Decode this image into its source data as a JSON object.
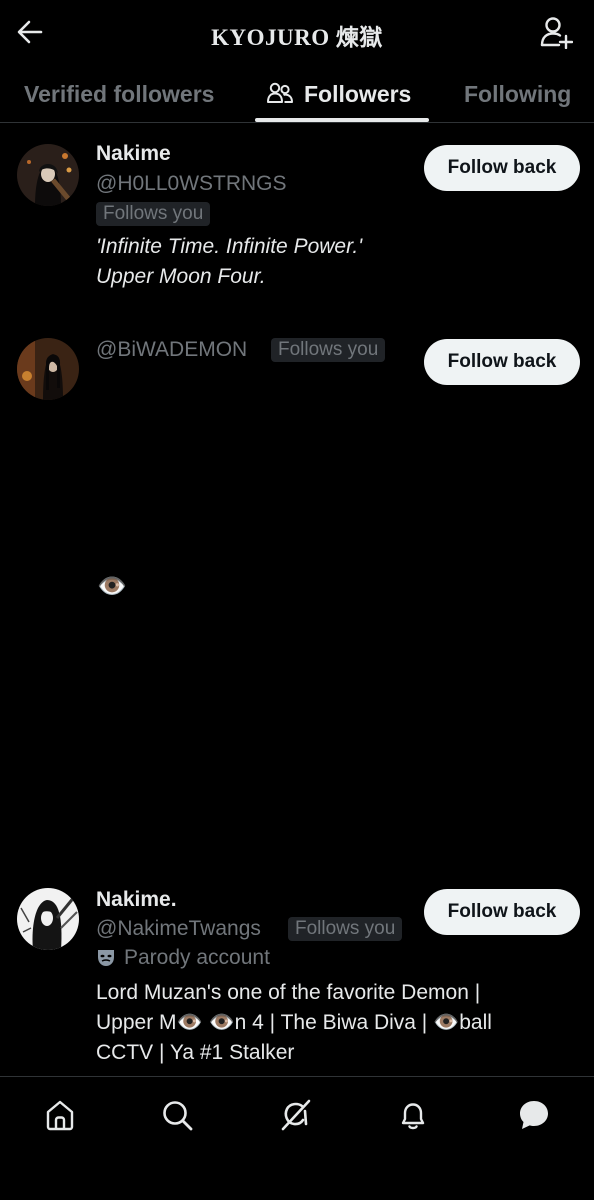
{
  "header": {
    "title": "KYOJURO 煉獄",
    "back_icon": "arrow-left-icon",
    "add_user_icon": "add-user-icon"
  },
  "tabs": [
    {
      "label": "Verified followers",
      "active": false
    },
    {
      "label": "Followers",
      "active": true,
      "icon": "people-icon"
    },
    {
      "label": "Following",
      "active": false
    }
  ],
  "followers": [
    {
      "name": "Nakime",
      "handle": "@H0LL0WSTRNGS",
      "follows_you": "Follows you",
      "button": "Follow back",
      "bio_line1": "'Infinite Time. Infinite Power.'",
      "bio_line2": "Upper Moon Four."
    },
    {
      "name": "",
      "handle": "@BiWADEMON",
      "follows_you": "Follows you",
      "button": "Follow back",
      "bio": "👁️"
    },
    {
      "name": "Nakime.",
      "handle": "@NakimeTwangs",
      "follows_you": "Follows you",
      "button": "Follow back",
      "parody": "Parody account",
      "parody_icon": "theater-mask-icon",
      "bio_line1": "Lord Muzan's one of the favorite Demon |",
      "bio_line2": "Upper M👁️ 👁️n 4 | The Biwa Diva | 👁️ball",
      "bio_line3": "CCTV | Ya #1 Stalker"
    }
  ],
  "bottom_nav": [
    "home-icon",
    "search-icon",
    "grok-icon",
    "notifications-icon",
    "messages-icon"
  ],
  "colors": {
    "background": "#000000",
    "text": "#e7e9ea",
    "muted": "#71767b",
    "button_bg": "#eff3f4",
    "button_text": "#0f1419",
    "badge_bg": "#202327"
  }
}
